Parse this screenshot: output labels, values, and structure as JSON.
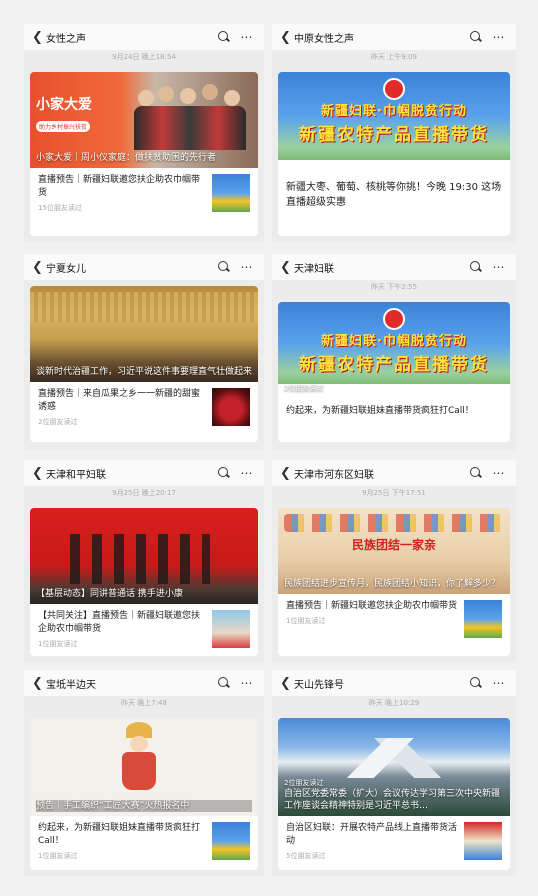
{
  "colors": {
    "brand_red": "#e13228",
    "text_muted": "#aaaaaa"
  },
  "panels": [
    {
      "title": "女性之声",
      "timestamp": "9月24日 晚上18:54",
      "cover_badge": "小家大爱",
      "cover_badge_sub": "助力乡村振兴扶贫",
      "cover_caption": "小家大爱｜周小仪家庭：做扶贫助困的先行者",
      "article_title": "直播预告｜新疆妇联邀您扶企助农巾帼带货",
      "reads": "15位朋友读过"
    },
    {
      "title": "中原女性之声",
      "timestamp": "昨天 上午9:09",
      "banner_line1": "新疆妇联·巾帼脱贫行动",
      "banner_line2": "新疆农特产品直播带货",
      "summary": "新疆大枣、葡萄、核桃等你挑！今晚 19:30 这场直播超级实惠"
    },
    {
      "title": "宁夏女儿",
      "cover_caption": "谈新时代治疆工作，习近平说这件事要理直气壮做起来",
      "article_title": "直播预告｜来自瓜果之乡一一新疆的甜蜜诱惑",
      "reads": "2位朋友读过"
    },
    {
      "title": "天津妇联",
      "timestamp": "昨天 下午2:55",
      "banner_line1": "新疆妇联·巾帼脱贫行动",
      "banner_line2": "新疆农特产品直播带货",
      "cover_caption": "2位朋友读过",
      "summary": "约起来，为新疆妇联姐妹直播带货疯狂打Call！"
    },
    {
      "title": "天津和平妇联",
      "timestamp": "9月25日 晚上20:17",
      "cover_caption": "【基层动态】同讲普通话 携手进小康",
      "article_title": "【共同关注】直播预告｜新疆妇联邀您扶企助农巾帼带货",
      "reads": "1位朋友读过"
    },
    {
      "title": "天津市河东区妇联",
      "timestamp": "9月25日 下午17:51",
      "cover_banner": "民族团结一家亲",
      "cover_caption": "民族团结进步宣传月，民族团结小知识，你了解多少？",
      "article_title": "直播预告｜新疆妇联邀您扶企助农巾帼带货",
      "reads": "1位朋友读过"
    },
    {
      "title": "宝坻半边天",
      "timestamp": "昨天 晚上7:48",
      "cover_caption": "预告｜手工编织“工匠大赛”火热报名中",
      "article_title": "约起来，为新疆妇联姐妹直播带货疯狂打 Call！",
      "reads": "1位朋友读过"
    },
    {
      "title": "天山先锋号",
      "timestamp": "昨天 晚上10:29",
      "cover_reads": "2位朋友读过",
      "cover_caption": "自治区党委常委（扩大）会议传达学习第三次中央新疆工作座谈会精神特别是习近平总书…",
      "article_title": "自治区妇联：开展农特产品线上直播带货活动",
      "reads": "5位朋友读过"
    }
  ]
}
